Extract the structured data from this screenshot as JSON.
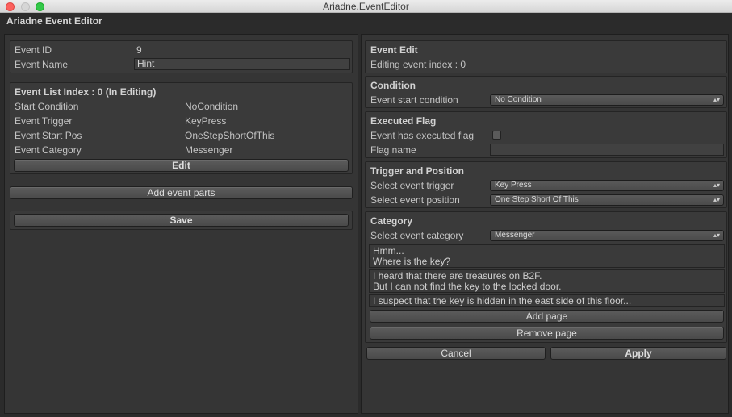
{
  "window": {
    "title": "Ariadne.EventEditor"
  },
  "editor_title": "Ariadne Event Editor",
  "left": {
    "event_id_label": "Event ID",
    "event_id_value": "9",
    "event_name_label": "Event Name",
    "event_name_value": "Hint",
    "list_header": "Event List Index : 0 (In Editing)",
    "rows": [
      {
        "label": "Start Condition",
        "value": "NoCondition"
      },
      {
        "label": "Event Trigger",
        "value": "KeyPress"
      },
      {
        "label": "Event Start Pos",
        "value": "OneStepShortOfThis"
      },
      {
        "label": "Event Category",
        "value": "Messenger"
      }
    ],
    "edit_button": "Edit",
    "add_parts_button": "Add event parts",
    "save_button": "Save"
  },
  "right": {
    "edit_header": "Event Edit",
    "editing_index": "Editing event index : 0",
    "condition_header": "Condition",
    "start_condition_label": "Event start condition",
    "start_condition_value": "No Condition",
    "flag_header": "Executed Flag",
    "executed_flag_label": "Event has executed flag",
    "executed_flag_checked": false,
    "flag_name_label": "Flag name",
    "flag_name_value": "",
    "trigger_header": "Trigger and Position",
    "trigger_label": "Select event trigger",
    "trigger_value": "Key Press",
    "position_label": "Select event position",
    "position_value": "One Step Short Of This",
    "category_header": "Category",
    "category_label": "Select event category",
    "category_value": "Messenger",
    "pages": [
      {
        "line1": "Hmm...",
        "line2": "Where is the key?"
      },
      {
        "line1": "I heard that there are treasures on B2F.",
        "line2": "But I can not find the key to the locked door."
      },
      {
        "line1": "I suspect that the key is hidden in the east side of this floor...",
        "line2": ""
      }
    ],
    "add_page_button": "Add page",
    "remove_page_button": "Remove page",
    "cancel_button": "Cancel",
    "apply_button": "Apply"
  },
  "colors": {
    "background": "#2b2b2b",
    "panel": "#353535",
    "button": "#555555",
    "text": "#c8c8c8"
  }
}
